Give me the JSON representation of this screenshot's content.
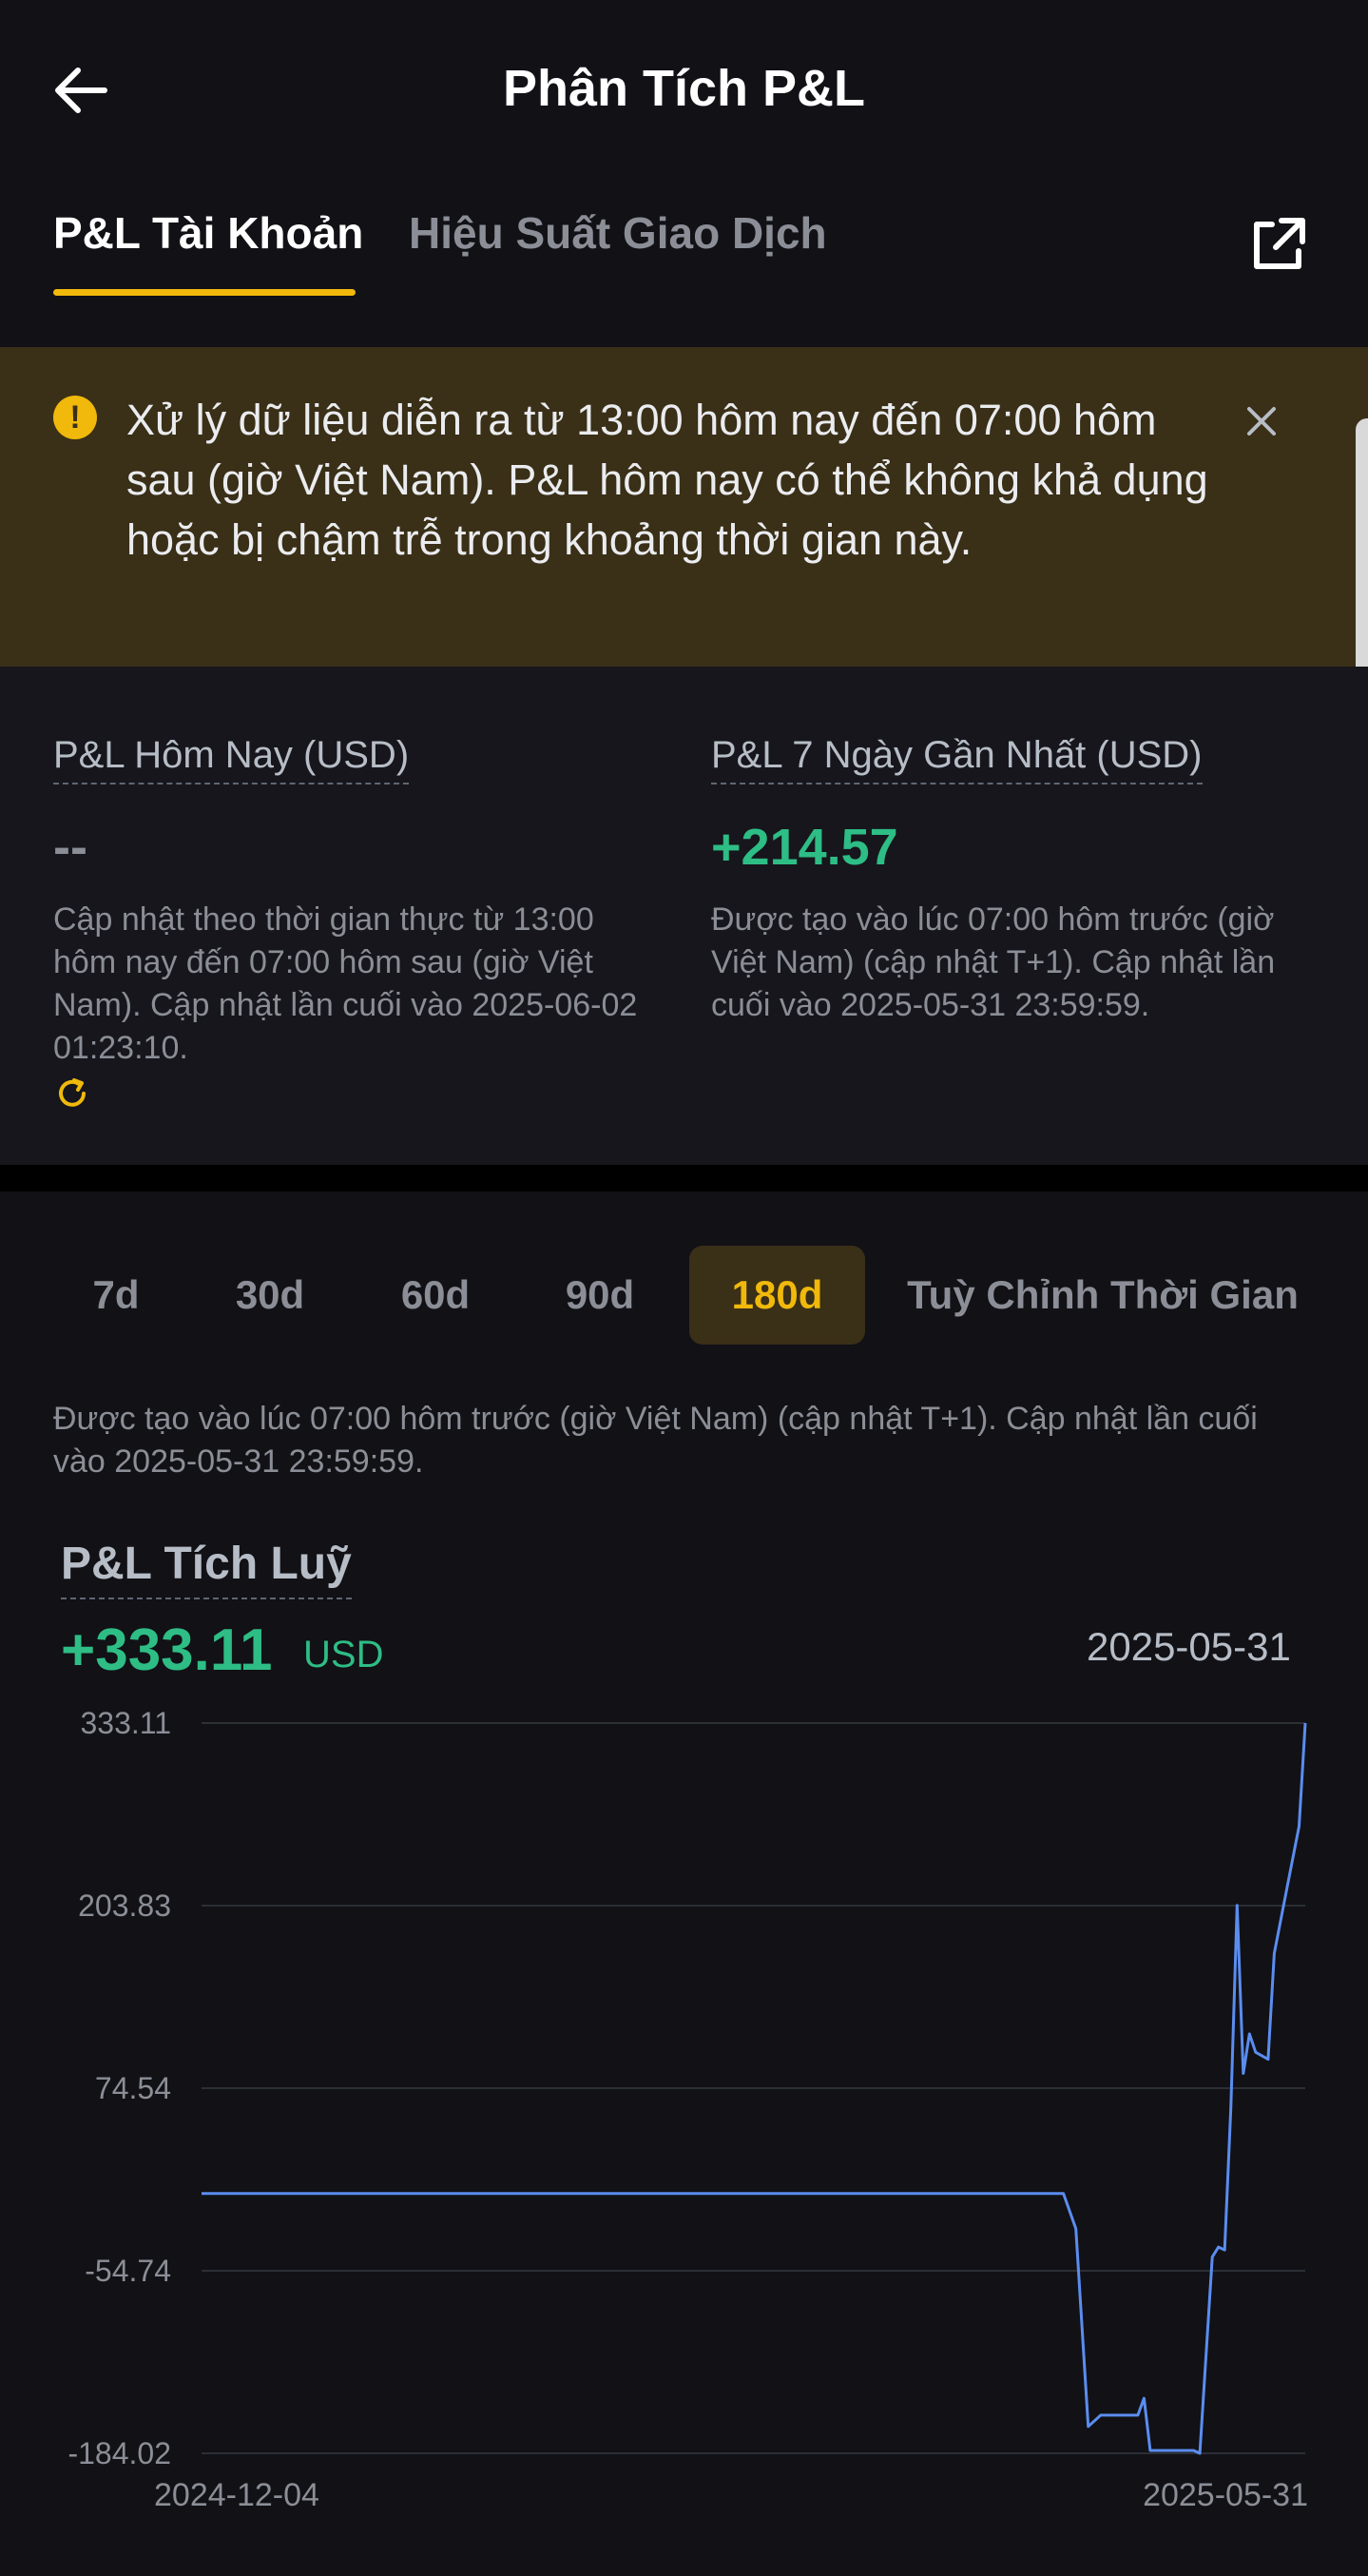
{
  "header": {
    "title": "Phân Tích P&L",
    "tabs": [
      {
        "label": "P&L Tài Khoản",
        "active": true
      },
      {
        "label": "Hiệu Suất Giao Dịch",
        "active": false
      }
    ]
  },
  "banner": {
    "text": "Xử lý dữ liệu diễn ra từ 13:00 hôm nay đến 07:00 hôm sau (giờ Việt Nam). P&L hôm nay có thể không khả dụng hoặc bị chậm trễ trong khoảng thời gian này."
  },
  "stats": {
    "today": {
      "label": "P&L Hôm Nay (USD)",
      "value": "--",
      "note": "Cập nhật theo thời gian thực từ 13:00 hôm nay đến 07:00 hôm sau (giờ Việt Nam). Cập nhật lần cuối vào 2025-06-02 01:23:10."
    },
    "week": {
      "label": "P&L 7 Ngày Gần Nhất (USD)",
      "value": "+214.57",
      "note": "Được tạo vào lúc 07:00 hôm trước (giờ Việt Nam) (cập nhật T+1). Cập nhật lần cuối vào 2025-05-31 23:59:59."
    }
  },
  "ranges": {
    "items": [
      "7d",
      "30d",
      "60d",
      "90d",
      "180d",
      "Tuỳ Chỉnh Thời Gian"
    ],
    "selected": "180d",
    "note": "Được tạo vào lúc 07:00 hôm trước (giờ Việt Nam) (cập nhật T+1). Cập nhật lần cuối vào 2025-05-31 23:59:59."
  },
  "chart": {
    "title": "P&L Tích Luỹ",
    "total": "+333.11",
    "unit": "USD",
    "date": "2025-05-31"
  },
  "colors": {
    "accent": "#f0b90b",
    "positive": "#2ebd85",
    "line": "#5b8def",
    "banner": "#3a2f17"
  },
  "chart_data": {
    "type": "line",
    "title": "P&L Tích Luỹ",
    "xlabel": "",
    "ylabel": "",
    "x_range": [
      "2024-12-04",
      "2025-05-31"
    ],
    "x_tick_labels": [
      "2024-12-04",
      "2025-05-31"
    ],
    "y_ticks": [
      333.11,
      203.83,
      74.54,
      -54.74,
      -184.02
    ],
    "ylim": [
      -184.02,
      333.11
    ],
    "grid": true,
    "series": [
      {
        "values": [
          {
            "x": "2024-12-04",
            "y": 0
          },
          {
            "x": "2025-04-22",
            "y": 0
          },
          {
            "x": "2025-04-24",
            "y": -25
          },
          {
            "x": "2025-04-26",
            "y": -165
          },
          {
            "x": "2025-04-28",
            "y": -157
          },
          {
            "x": "2025-05-04",
            "y": -157
          },
          {
            "x": "2025-05-05",
            "y": -145
          },
          {
            "x": "2025-05-06",
            "y": -182
          },
          {
            "x": "2025-05-13",
            "y": -182
          },
          {
            "x": "2025-05-14",
            "y": -184
          },
          {
            "x": "2025-05-16",
            "y": -45
          },
          {
            "x": "2025-05-17",
            "y": -38
          },
          {
            "x": "2025-05-18",
            "y": -40
          },
          {
            "x": "2025-05-19",
            "y": 60
          },
          {
            "x": "2025-05-20",
            "y": 204
          },
          {
            "x": "2025-05-21",
            "y": 85
          },
          {
            "x": "2025-05-22",
            "y": 113
          },
          {
            "x": "2025-05-23",
            "y": 100
          },
          {
            "x": "2025-05-25",
            "y": 95
          },
          {
            "x": "2025-05-26",
            "y": 170
          },
          {
            "x": "2025-05-28",
            "y": 215
          },
          {
            "x": "2025-05-30",
            "y": 260
          },
          {
            "x": "2025-05-31",
            "y": 333.11
          }
        ]
      }
    ]
  }
}
